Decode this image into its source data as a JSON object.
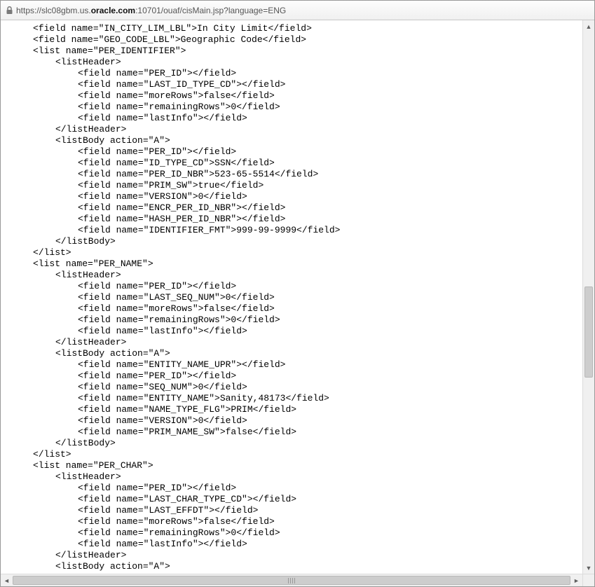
{
  "address": {
    "prefix": "https://slc08gbm.us.",
    "host": "oracle.com",
    "suffix": ":10701/ouaf/cisMain.jsp?language=ENG"
  },
  "lines": [
    {
      "i": 1,
      "t": "<field name=\"IN_CITY_LIM_LBL\">In City Limit</field>"
    },
    {
      "i": 1,
      "t": "<field name=\"GEO_CODE_LBL\">Geographic Code</field>"
    },
    {
      "i": 1,
      "t": "<list name=\"PER_IDENTIFIER\">"
    },
    {
      "i": 2,
      "t": "<listHeader>"
    },
    {
      "i": 3,
      "t": "<field name=\"PER_ID\"></field>"
    },
    {
      "i": 3,
      "t": "<field name=\"LAST_ID_TYPE_CD\"></field>"
    },
    {
      "i": 3,
      "t": "<field name=\"moreRows\">false</field>"
    },
    {
      "i": 3,
      "t": "<field name=\"remainingRows\">0</field>"
    },
    {
      "i": 3,
      "t": "<field name=\"lastInfo\"></field>"
    },
    {
      "i": 2,
      "t": "</listHeader>"
    },
    {
      "i": 2,
      "t": "<listBody action=\"A\">"
    },
    {
      "i": 3,
      "t": "<field name=\"PER_ID\"></field>"
    },
    {
      "i": 3,
      "t": "<field name=\"ID_TYPE_CD\">SSN</field>"
    },
    {
      "i": 3,
      "t": "<field name=\"PER_ID_NBR\">523-65-5514</field>"
    },
    {
      "i": 3,
      "t": "<field name=\"PRIM_SW\">true</field>"
    },
    {
      "i": 3,
      "t": "<field name=\"VERSION\">0</field>"
    },
    {
      "i": 3,
      "t": "<field name=\"ENCR_PER_ID_NBR\"></field>"
    },
    {
      "i": 3,
      "t": "<field name=\"HASH_PER_ID_NBR\"></field>"
    },
    {
      "i": 3,
      "t": "<field name=\"IDENTIFIER_FMT\">999-99-9999</field>"
    },
    {
      "i": 2,
      "t": "</listBody>"
    },
    {
      "i": 1,
      "t": "</list>"
    },
    {
      "i": 1,
      "t": "<list name=\"PER_NAME\">"
    },
    {
      "i": 2,
      "t": "<listHeader>"
    },
    {
      "i": 3,
      "t": "<field name=\"PER_ID\"></field>"
    },
    {
      "i": 3,
      "t": "<field name=\"LAST_SEQ_NUM\">0</field>"
    },
    {
      "i": 3,
      "t": "<field name=\"moreRows\">false</field>"
    },
    {
      "i": 3,
      "t": "<field name=\"remainingRows\">0</field>"
    },
    {
      "i": 3,
      "t": "<field name=\"lastInfo\"></field>"
    },
    {
      "i": 2,
      "t": "</listHeader>"
    },
    {
      "i": 2,
      "t": "<listBody action=\"A\">"
    },
    {
      "i": 3,
      "t": "<field name=\"ENTITY_NAME_UPR\"></field>"
    },
    {
      "i": 3,
      "t": "<field name=\"PER_ID\"></field>"
    },
    {
      "i": 3,
      "t": "<field name=\"SEQ_NUM\">0</field>"
    },
    {
      "i": 3,
      "t": "<field name=\"ENTITY_NAME\">Sanity,48173</field>"
    },
    {
      "i": 3,
      "t": "<field name=\"NAME_TYPE_FLG\">PRIM</field>"
    },
    {
      "i": 3,
      "t": "<field name=\"VERSION\">0</field>"
    },
    {
      "i": 3,
      "t": "<field name=\"PRIM_NAME_SW\">false</field>"
    },
    {
      "i": 2,
      "t": "</listBody>"
    },
    {
      "i": 1,
      "t": "</list>"
    },
    {
      "i": 1,
      "t": "<list name=\"PER_CHAR\">"
    },
    {
      "i": 2,
      "t": "<listHeader>"
    },
    {
      "i": 3,
      "t": "<field name=\"PER_ID\"></field>"
    },
    {
      "i": 3,
      "t": "<field name=\"LAST_CHAR_TYPE_CD\"></field>"
    },
    {
      "i": 3,
      "t": "<field name=\"LAST_EFFDT\"></field>"
    },
    {
      "i": 3,
      "t": "<field name=\"moreRows\">false</field>"
    },
    {
      "i": 3,
      "t": "<field name=\"remainingRows\">0</field>"
    },
    {
      "i": 3,
      "t": "<field name=\"lastInfo\"></field>"
    },
    {
      "i": 2,
      "t": "</listHeader>"
    },
    {
      "i": 2,
      "t": "<listBody action=\"A\">"
    }
  ]
}
